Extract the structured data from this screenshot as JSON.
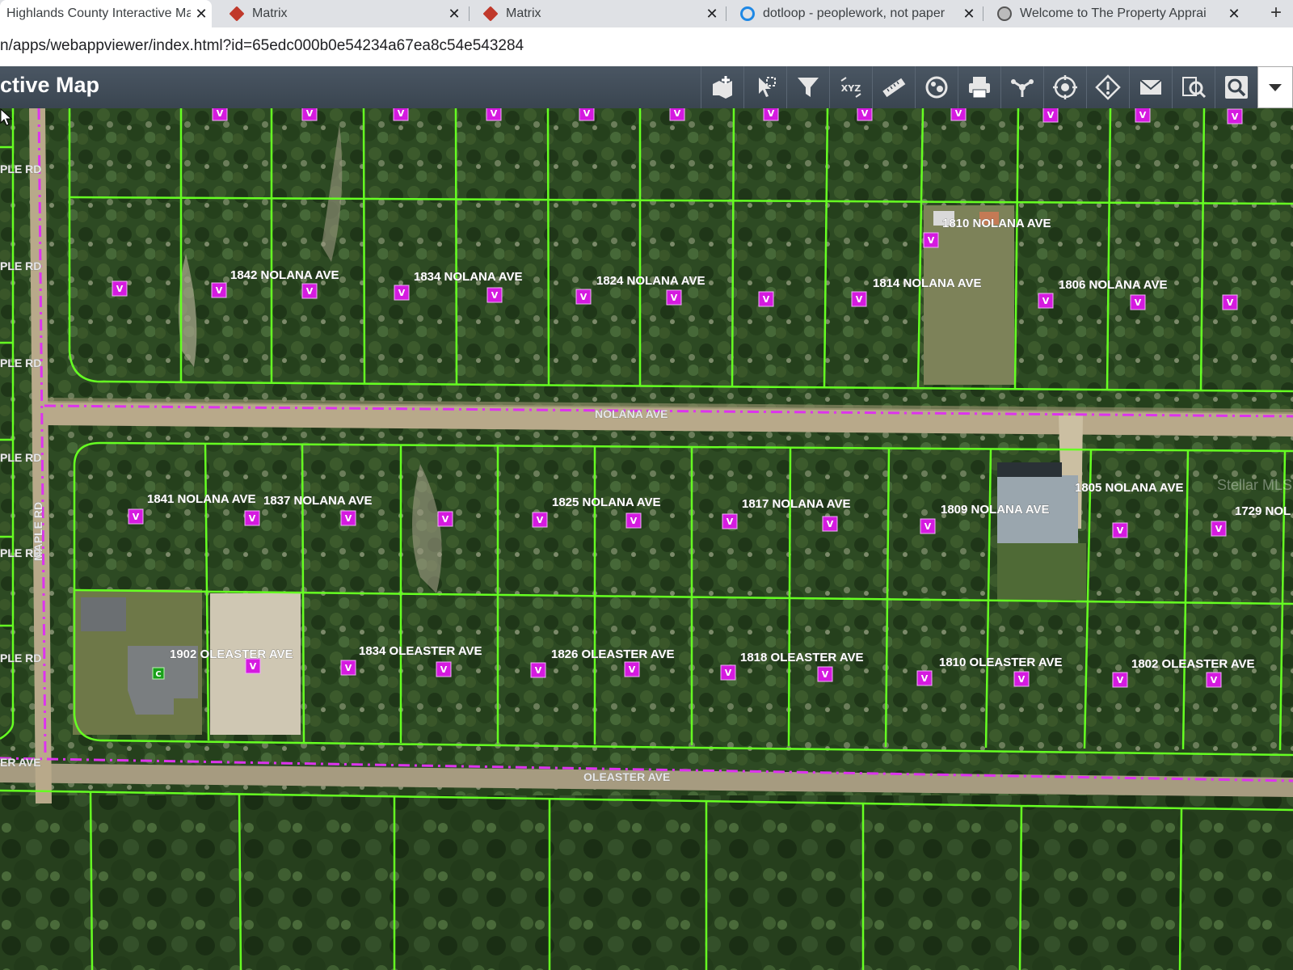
{
  "browser": {
    "tabs": [
      {
        "title": "Highlands County Interactive Ma",
        "icon": "map-icon",
        "active": true
      },
      {
        "title": "Matrix",
        "icon": "matrix-icon",
        "active": false
      },
      {
        "title": "Matrix",
        "icon": "matrix-icon",
        "active": false
      },
      {
        "title": "dotloop - peoplework, not paper",
        "icon": "dotloop-icon",
        "active": false
      },
      {
        "title": "Welcome to The Property Apprai",
        "icon": "appraiser-icon",
        "active": false
      }
    ],
    "close_glyph": "✕",
    "new_tab_glyph": "+",
    "url": "n/apps/webappviewer/index.html?id=65edc000b0e54234a67ea8c54e543284"
  },
  "app": {
    "title": "ctive Map",
    "tools": [
      "add-data-icon",
      "select-icon",
      "filter-icon",
      "xyz-coordinate-icon",
      "measure-icon",
      "layer-visibility-icon",
      "print-icon",
      "share-icon",
      "location-icon",
      "report-icon",
      "email-icon",
      "query-icon",
      "search-icon",
      "chevron-down-icon"
    ],
    "tool_labels": {
      "xyz": "XYZ"
    }
  },
  "map": {
    "colors": {
      "parcel_line": "#66ff22",
      "road_centerline": "#dd33ee",
      "marker": "#d51ae0"
    },
    "roads": {
      "nolana": "NOLANA AVE",
      "oleaster": "OLEASTER AVE",
      "maple_vertical": "MAPLE RD",
      "maple_left": [
        "PLE RD",
        "PLE RD",
        "PLE RD",
        "PLE RD",
        "PLE RD",
        "PLE RD"
      ],
      "oleaster_left": "ER AVE"
    },
    "addresses": [
      "1842 NOLANA AVE",
      "1834 NOLANA AVE",
      "1824 NOLANA AVE",
      "1814 NOLANA AVE",
      "1810 NOLANA AVE",
      "1806 NOLANA AVE",
      "1841 NOLANA AVE",
      "1837 NOLANA AVE",
      "1825 NOLANA AVE",
      "1817 NOLANA AVE",
      "1809 NOLANA AVE",
      "1805 NOLANA AVE",
      "1729 NOL",
      "1902 OLEASTER AVE",
      "1834 OLEASTER AVE",
      "1826 OLEASTER AVE",
      "1818 OLEASTER AVE",
      "1810 OLEASTER AVE",
      "1802 OLEASTER AVE"
    ],
    "marker_letter": "V",
    "developed_marker_letter": "C",
    "watermark": "Stellar MLS"
  }
}
